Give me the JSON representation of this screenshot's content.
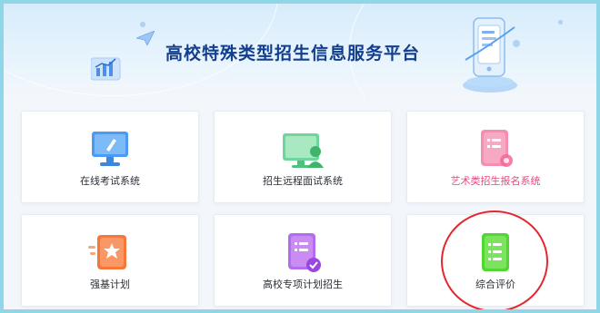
{
  "header": {
    "title": "高校特殊类型招生信息服务平台"
  },
  "cards": [
    {
      "label": "在线考试系统",
      "icon": "monitor-pen-icon",
      "color": "#3b8ef0"
    },
    {
      "label": "招生远程面试系统",
      "icon": "video-interview-icon",
      "color": "#4cc27a"
    },
    {
      "label": "艺术类招生报名系统",
      "icon": "document-badge-icon",
      "color": "#f26a95"
    },
    {
      "label": "强基计划",
      "icon": "star-document-icon",
      "color": "#f5773c"
    },
    {
      "label": "高校专项计划招生",
      "icon": "checked-document-icon",
      "color": "#b05ae8"
    },
    {
      "label": "综合评价",
      "icon": "list-document-icon",
      "color": "#52d633"
    }
  ],
  "colors": {
    "title": "#123e8e",
    "highlight_circle": "#e6262e",
    "art_label": "#e34a82"
  }
}
